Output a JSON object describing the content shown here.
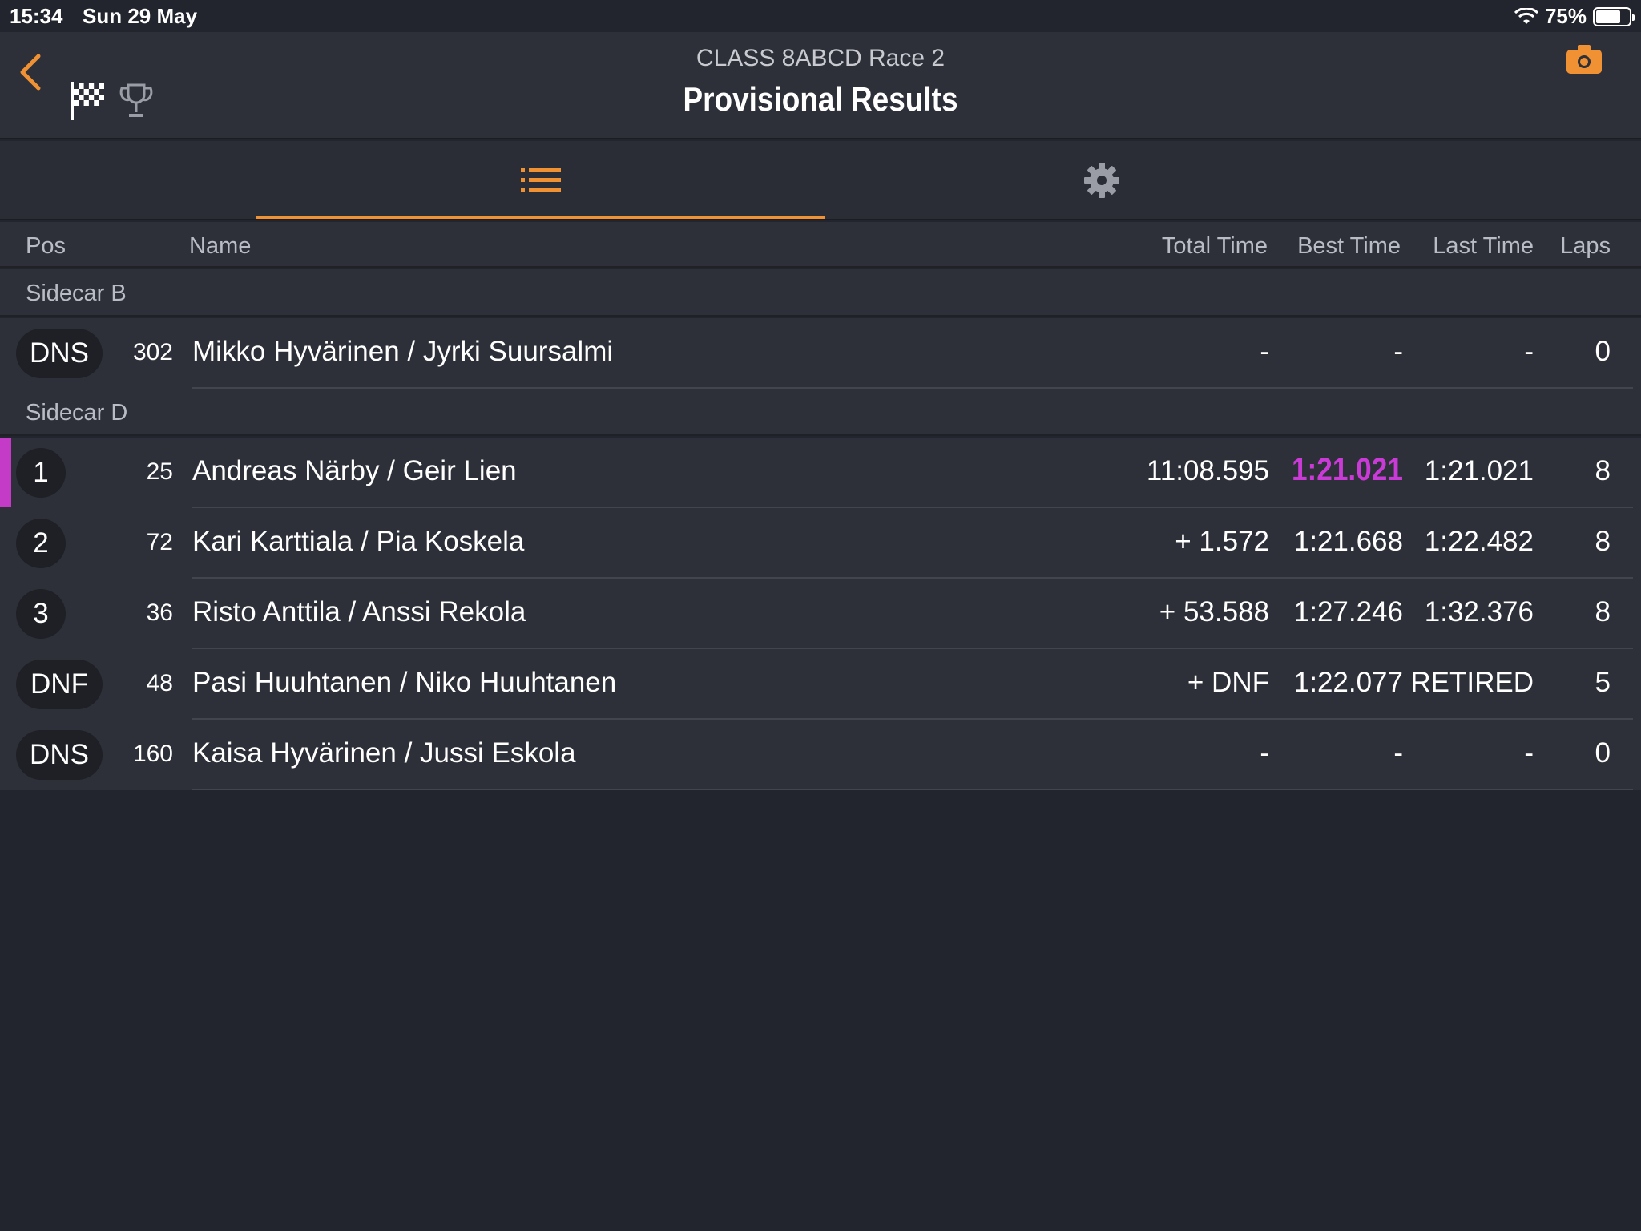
{
  "status": {
    "time": "15:34",
    "date": "Sun 29 May",
    "battery": "75%",
    "battery_level": 0.75
  },
  "nav": {
    "subtitle": "CLASS 8ABCD Race 2",
    "title": "Provisional Results"
  },
  "columns": {
    "pos": "Pos",
    "name": "Name",
    "total": "Total Time",
    "best": "Best Time",
    "last": "Last Time",
    "laps": "Laps"
  },
  "groups": [
    {
      "label": "Sidecar B",
      "rows": [
        {
          "pos": "DNS",
          "num": "302",
          "name": "Mikko Hyvärinen /  Jyrki Suursalmi",
          "total": "-",
          "best": "-",
          "last": "-",
          "laps": "0"
        }
      ]
    },
    {
      "label": "Sidecar D",
      "rows": [
        {
          "pos": "1",
          "num": "25",
          "name": "Andreas Närby / Geir Lien",
          "total": "11:08.595",
          "best": "1:21.021",
          "last": "1:21.021",
          "laps": "8"
        },
        {
          "pos": "2",
          "num": "72",
          "name": "Kari Karttiala / Pia Koskela",
          "total": "+ 1.572",
          "best": "1:21.668",
          "last": "1:22.482",
          "laps": "8"
        },
        {
          "pos": "3",
          "num": "36",
          "name": "Risto Anttila / Anssi Rekola",
          "total": "+ 53.588",
          "best": "1:27.246",
          "last": "1:32.376",
          "laps": "8"
        },
        {
          "pos": "DNF",
          "num": "48",
          "name": "Pasi Huuhtanen / Niko Huuhtanen",
          "total": "+ DNF",
          "best": "1:22.077",
          "last": "RETIRED",
          "laps": "5"
        },
        {
          "pos": "DNS",
          "num": "160",
          "name": "Kaisa Hyvärinen / Jussi Eskola",
          "total": "-",
          "best": "-",
          "last": "-",
          "laps": "0"
        }
      ]
    }
  ],
  "colors": {
    "accent": "#f09133",
    "fastest": "#c93ad6",
    "background": "#22252d",
    "row": "#2d3039"
  },
  "icons": [
    "back-chevron-icon",
    "checkered-flag-icon",
    "trophy-icon",
    "camera-icon",
    "list-icon",
    "gear-icon",
    "wifi-icon",
    "battery-icon"
  ]
}
